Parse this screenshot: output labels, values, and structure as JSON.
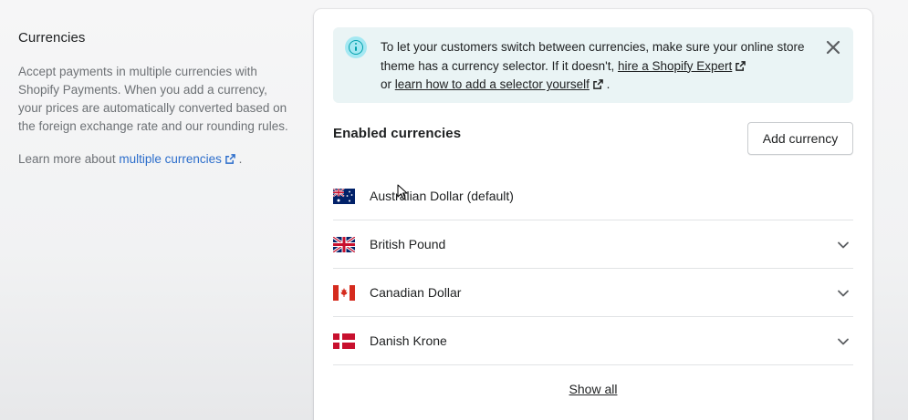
{
  "settings": {
    "title": "Currencies",
    "description": "Accept payments in multiple currencies with Shopify Payments. When you add a currency, your prices are automatically converted based on the foreign exchange rate and our rounding rules.",
    "learn_prefix": "Learn more about ",
    "learn_link": "multiple currencies",
    "learn_suffix": " ."
  },
  "banner": {
    "text_1": "To let your customers switch between currencies, make sure your online store theme has a currency selector. If it doesn't, ",
    "link_1": "hire a Shopify Expert",
    "text_2": "or ",
    "link_2": "learn how to add a selector yourself",
    "text_3": " .",
    "icon": "info-icon"
  },
  "enabled": {
    "title": "Enabled currencies",
    "add_label": "Add currency",
    "show_all": "Show all",
    "currencies": [
      {
        "name": "Australian Dollar (default)",
        "flag": "au",
        "expandable": false
      },
      {
        "name": "British Pound",
        "flag": "gb",
        "expandable": true
      },
      {
        "name": "Canadian Dollar",
        "flag": "ca",
        "expandable": true
      },
      {
        "name": "Danish Krone",
        "flag": "dk",
        "expandable": true
      }
    ]
  },
  "colors": {
    "link": "#2c6ecb",
    "banner_bg": "#eaf4f5",
    "info_accent": "#00a0ac"
  }
}
